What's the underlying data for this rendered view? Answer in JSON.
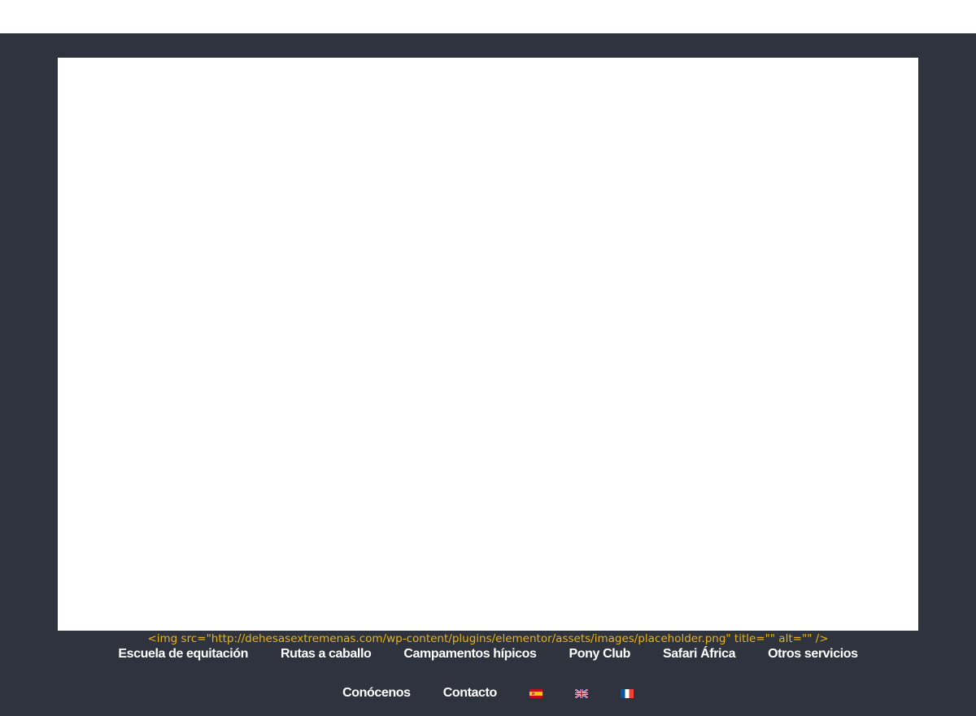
{
  "image_placeholder": {
    "code_text": "<img src=\"http://dehesasextremenas.com/wp-content/plugins/elementor/assets/images/placeholder.png\" title=\"\" alt=\"\" />"
  },
  "nav": {
    "primary": [
      {
        "label": "Escuela de equitación"
      },
      {
        "label": "Rutas a caballo"
      },
      {
        "label": "Campamentos hípicos"
      },
      {
        "label": "Pony Club"
      },
      {
        "label": "Safari África"
      },
      {
        "label": "Otros servicios"
      }
    ],
    "secondary": [
      {
        "label": "Conócenos"
      },
      {
        "label": "Contacto"
      }
    ],
    "languages": [
      {
        "icon": "spain-flag-icon"
      },
      {
        "icon": "uk-flag-icon"
      },
      {
        "icon": "france-flag-icon"
      }
    ]
  },
  "colors": {
    "panel_bg": "#2f333d",
    "code_text": "#e8b410",
    "nav_text": "#ffffff"
  }
}
